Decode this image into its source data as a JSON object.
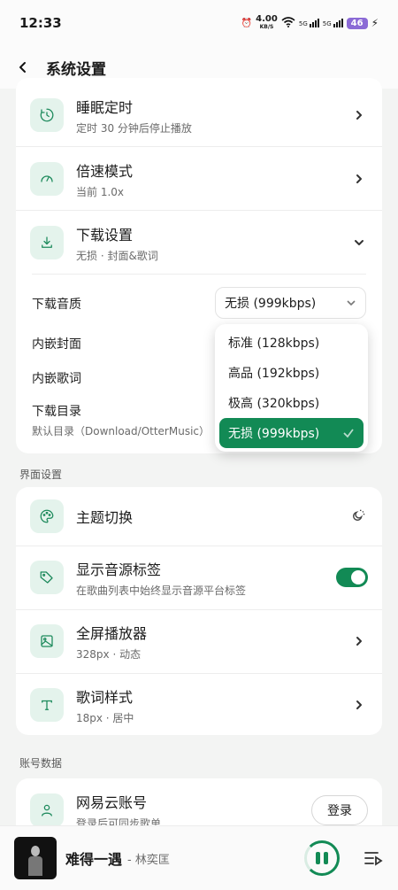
{
  "status_bar": {
    "time": "12:33",
    "net_speed_value": "4.00",
    "net_speed_unit": "KB/S",
    "sim1": "5G",
    "sim2": "5G",
    "battery": "46"
  },
  "app_bar": {
    "back_icon": "back-arrow-icon",
    "title": "系统设置"
  },
  "playback_card": {
    "items": [
      {
        "icon": "timer-icon",
        "title": "睡眠定时",
        "subtitle": "定时 30 分钟后停止播放"
      },
      {
        "icon": "speedometer-icon",
        "title": "倍速模式",
        "subtitle": "当前 1.0x"
      },
      {
        "icon": "download-icon",
        "title": "下载设置",
        "subtitle": "无损 · 封面&歌词"
      }
    ]
  },
  "download_settings": {
    "quality_label": "下载音质",
    "quality_value": "无损 (999kbps)",
    "embed_cover_label": "内嵌封面",
    "embed_lyrics_label": "内嵌歌词",
    "dir_label": "下载目录",
    "dir_value": "默认目录（Download/OtterMusic）",
    "options": [
      "标准 (128kbps)",
      "高品 (192kbps)",
      "极高 (320kbps)",
      "无损 (999kbps)"
    ]
  },
  "ui_section": {
    "label": "界面设置",
    "items": [
      {
        "icon": "palette-icon",
        "title": "主题切换",
        "subtitle": ""
      },
      {
        "icon": "tag-icon",
        "title": "显示音源标签",
        "subtitle": "在歌曲列表中始终显示音源平台标签"
      },
      {
        "icon": "image-icon",
        "title": "全屏播放器",
        "subtitle": "328px · 动态"
      },
      {
        "icon": "text-t-icon",
        "title": "歌词样式",
        "subtitle": "18px · 居中"
      }
    ]
  },
  "account_section": {
    "label": "账号数据",
    "items": [
      {
        "icon": "user-icon",
        "title": "网易云账号",
        "subtitle": "登录后可同步歌单",
        "button": "登录"
      }
    ]
  },
  "player": {
    "song": "难得一遇",
    "artist": "- 林奕匡",
    "accent": "#128a55"
  }
}
